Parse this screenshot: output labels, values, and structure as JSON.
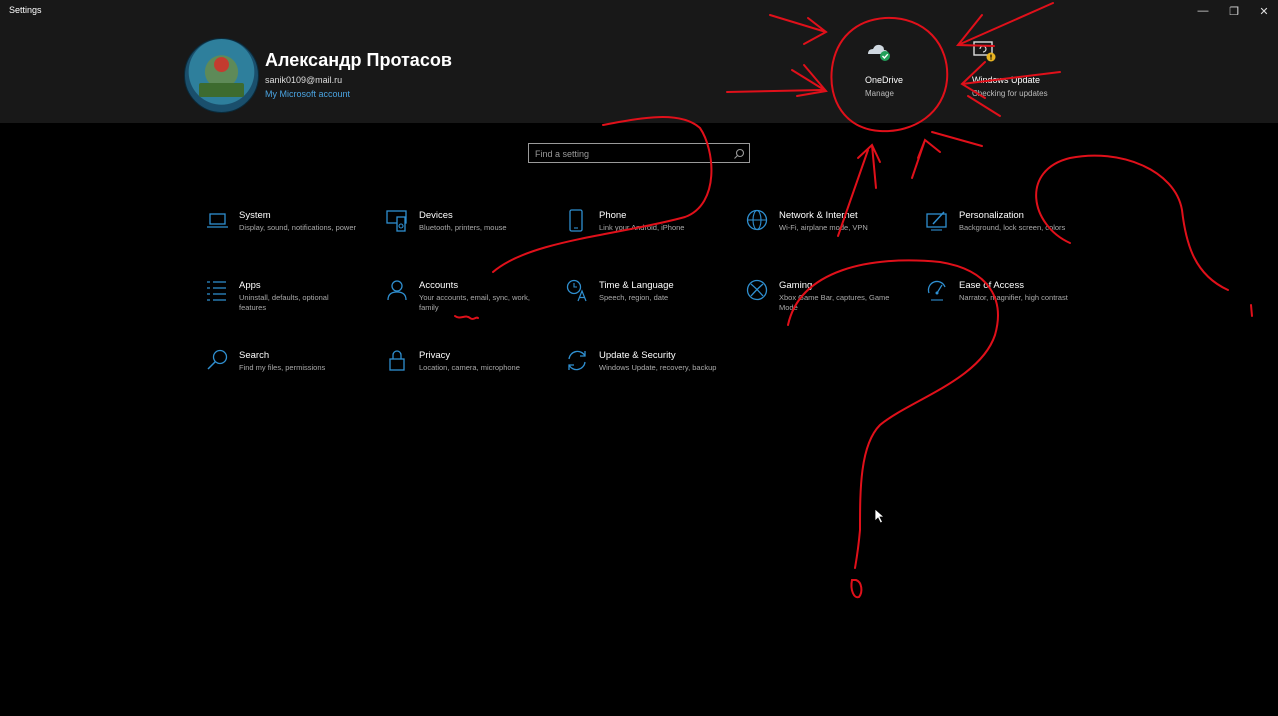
{
  "window": {
    "title": "Settings",
    "controls": {
      "minimize": "—",
      "maximize": "❐",
      "close": "✕"
    }
  },
  "header": {
    "user_name": "Александр Протасов",
    "email": "sanik0109@mail.ru",
    "account_link": "My Microsoft account",
    "quick_actions": [
      {
        "title": "OneDrive",
        "subtitle": "Manage",
        "icon": "onedrive-icon"
      },
      {
        "title": "Windows Update",
        "subtitle": "Checking for updates",
        "icon": "windows-update-icon"
      }
    ]
  },
  "search": {
    "placeholder": "Find a setting"
  },
  "categories": [
    {
      "title": "System",
      "desc": "Display, sound, notifications, power",
      "icon": "laptop-icon"
    },
    {
      "title": "Devices",
      "desc": "Bluetooth, printers, mouse",
      "icon": "devices-icon"
    },
    {
      "title": "Phone",
      "desc": "Link your Android, iPhone",
      "icon": "phone-icon"
    },
    {
      "title": "Network & Internet",
      "desc": "Wi-Fi, airplane mode, VPN",
      "icon": "globe-icon"
    },
    {
      "title": "Personalization",
      "desc": "Background, lock screen, colors",
      "icon": "personalization-icon"
    },
    {
      "title": "Apps",
      "desc": "Uninstall, defaults, optional features",
      "icon": "apps-list-icon"
    },
    {
      "title": "Accounts",
      "desc": "Your accounts, email, sync, work, family",
      "icon": "person-icon"
    },
    {
      "title": "Time & Language",
      "desc": "Speech, region, date",
      "icon": "time-language-icon"
    },
    {
      "title": "Gaming",
      "desc": "Xbox Game Bar, captures, Game Mode",
      "icon": "xbox-icon"
    },
    {
      "title": "Ease of Access",
      "desc": "Narrator, magnifier, high contrast",
      "icon": "ease-of-access-icon"
    },
    {
      "title": "Search",
      "desc": "Find my files, permissions",
      "icon": "search-icon"
    },
    {
      "title": "Privacy",
      "desc": "Location, camera, microphone",
      "icon": "lock-icon"
    },
    {
      "title": "Update & Security",
      "desc": "Windows Update, recovery, backup",
      "icon": "sync-icon"
    }
  ],
  "colors": {
    "accent": "#2f8fd0",
    "header_bg": "#181818",
    "background": "#000000",
    "annotation_red": "#e0101a"
  }
}
